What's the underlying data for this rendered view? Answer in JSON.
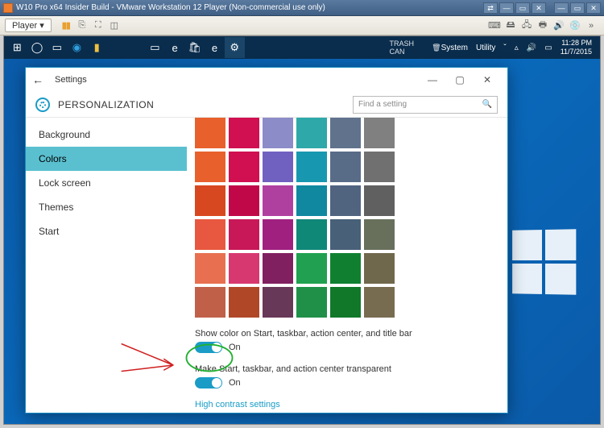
{
  "host": {
    "title": "W10 Pro x64 Insider Build - VMware Workstation 12 Player (Non-commercial use only)",
    "ctrls": {
      "min": "—",
      "max": "▭",
      "close": "✕"
    },
    "top_icons": {
      "a": "⇄",
      "b": "—",
      "c": "▭",
      "d": "✕"
    }
  },
  "vmware": {
    "player_label": "Player ▾"
  },
  "guest": {
    "trash": "TRASH CAN",
    "sys": "System",
    "util": "Utility",
    "time": "11:28 PM",
    "date": "11/7/2015"
  },
  "settings": {
    "app_name": "Settings",
    "header": "PERSONALIZATION",
    "search_placeholder": "Find a setting",
    "win_ctrls": {
      "min": "—",
      "max": "▢",
      "close": "✕"
    },
    "sidebar": [
      {
        "label": "Background",
        "selected": false
      },
      {
        "label": "Colors",
        "selected": true
      },
      {
        "label": "Lock screen",
        "selected": false
      },
      {
        "label": "Themes",
        "selected": false
      },
      {
        "label": "Start",
        "selected": false
      }
    ],
    "swatches": [
      "#e8602c",
      "#d01050",
      "#8c8cc8",
      "#2ea8a8",
      "#60728c",
      "#808080",
      "#e8602c",
      "#d01050",
      "#7060c0",
      "#1898b0",
      "#586c88",
      "#707070",
      "#d84820",
      "#c00848",
      "#b040a0",
      "#1088a0",
      "#506480",
      "#606060",
      "#e85840",
      "#c81858",
      "#a02080",
      "#108878",
      "#486078",
      "#68705c",
      "#e87050",
      "#d83870",
      "#802060",
      "#20a050",
      "#108030",
      "#70684c",
      "#c06048",
      "#b04828",
      "#683858",
      "#209048",
      "#107828",
      "#786c50"
    ],
    "opt1_label": "Show color on Start, taskbar, action center, and title bar",
    "opt1_state": "On",
    "opt2_label": "Make Start, taskbar, and action center transparent",
    "opt2_state": "On",
    "link": "High contrast settings"
  }
}
